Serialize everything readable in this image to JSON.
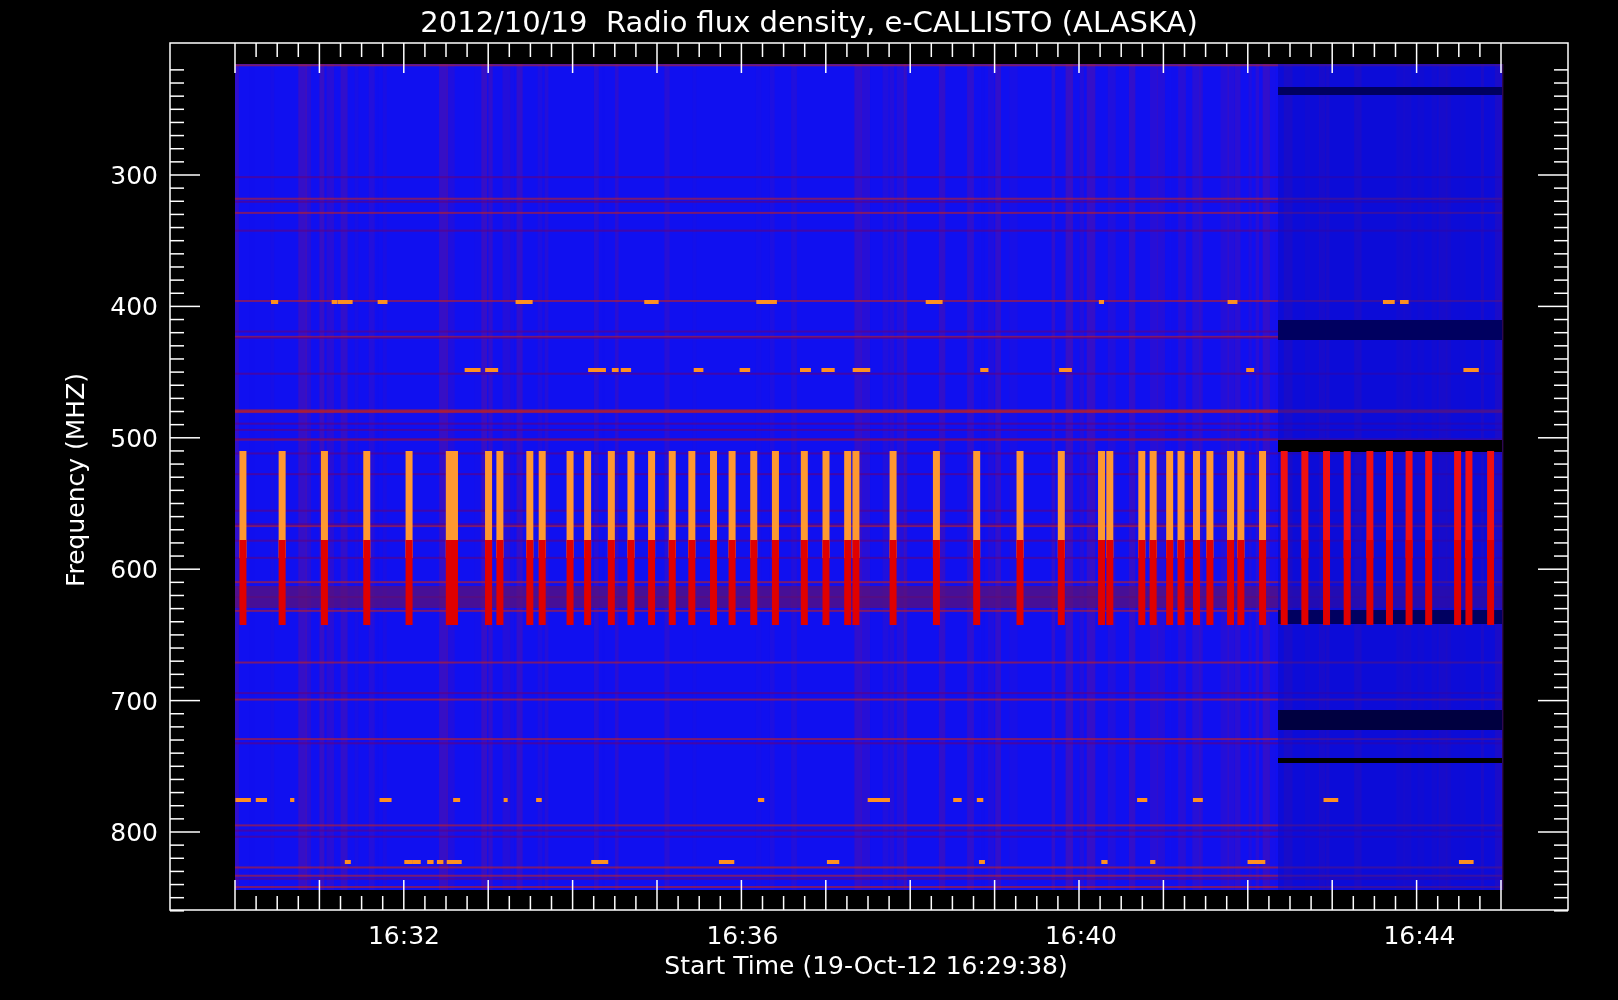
{
  "title": "2012/10/19  Radio flux density, e-CALLISTO (ALASKA)",
  "y_axis": {
    "label": "Frequency (MHZ)",
    "ticks": [
      "300",
      "400",
      "500",
      "600",
      "700",
      "800"
    ]
  },
  "x_axis": {
    "label": "Start Time (19-Oct-12 16:29:38)",
    "ticks": [
      "16:32",
      "16:36",
      "16:40",
      "16:44"
    ]
  }
}
